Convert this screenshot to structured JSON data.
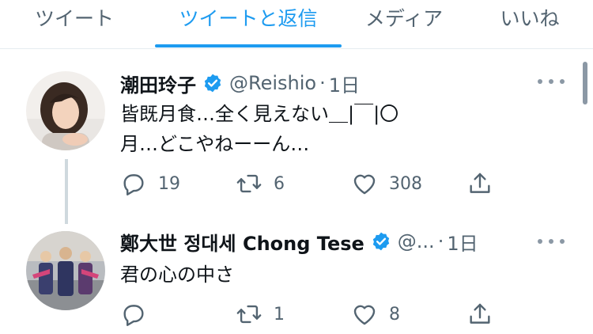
{
  "tabs": [
    {
      "label": "ツイート"
    },
    {
      "label": "ツイートと返信"
    },
    {
      "label": "メディア"
    },
    {
      "label": "いいね"
    }
  ],
  "active_tab_color": "#1d9bf0",
  "tweets": [
    {
      "name": "潮田玲子",
      "handle": "@Reishio",
      "dot": "·",
      "time": "1日",
      "verified": true,
      "text_lines": [
        "皆既月食…全く見えない＿|￣|〇",
        "月…どこやねーーん…"
      ],
      "replies": "19",
      "retweets": "6",
      "likes": "308"
    },
    {
      "name": "鄭大世 정대세 Chong Tese",
      "handle": "@...",
      "dot": "·",
      "time": "1日",
      "verified": true,
      "text_lines": [
        "君の心の中さ"
      ],
      "replies": "",
      "retweets": "1",
      "likes": "8"
    }
  ],
  "icons": {
    "reply": "reply-icon",
    "retweet": "retweet-icon",
    "like": "heart-icon",
    "share": "share-icon",
    "verified": "verified-badge-icon",
    "more": "more-options-icon"
  },
  "colors": {
    "verified_blue": "#1d9bf0",
    "secondary_text": "#536471"
  }
}
